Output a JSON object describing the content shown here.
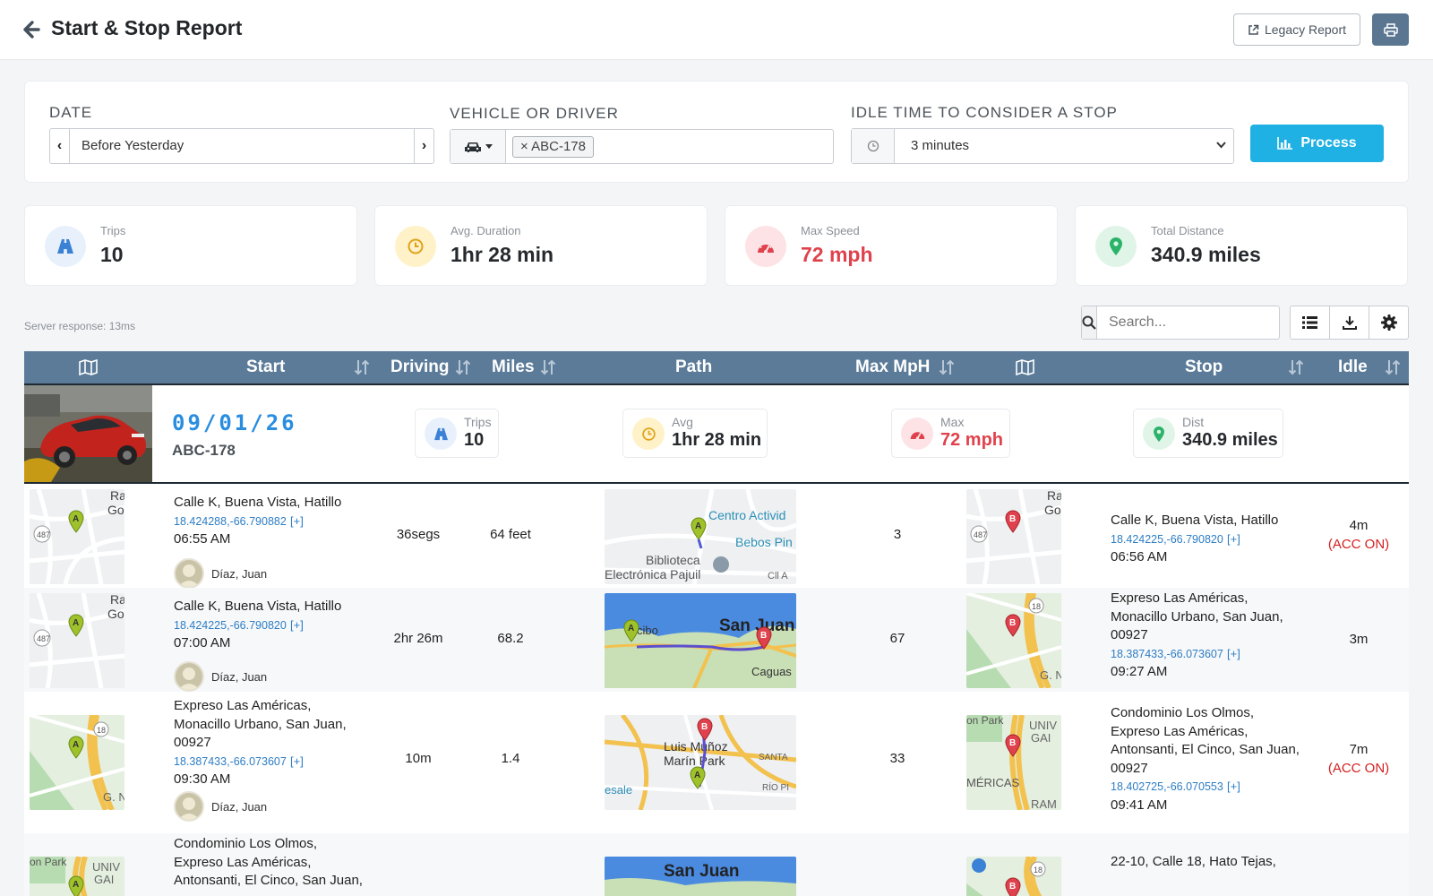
{
  "header": {
    "title": "Start & Stop Report",
    "legacy_label": "Legacy Report"
  },
  "filters": {
    "date_label": "DATE",
    "date_value": "Before Yesterday",
    "vehicle_label": "VEHICLE OR DRIVER",
    "vehicle_chip": "ABC-178",
    "idle_label": "IDLE TIME TO CONSIDER A STOP",
    "idle_value": "3 minutes",
    "process_label": "Process"
  },
  "stats": [
    {
      "label": "Trips",
      "value": "10",
      "icon": "road-icon"
    },
    {
      "label": "Avg. Duration",
      "value": "1hr 28 min",
      "icon": "clock-icon"
    },
    {
      "label": "Max Speed",
      "value": "72 mph",
      "icon": "speedometer-icon"
    },
    {
      "label": "Total Distance",
      "value": "340.9 miles",
      "icon": "map-marker-icon"
    }
  ],
  "server_response": "Server response: 13ms",
  "search": {
    "placeholder": "Search..."
  },
  "table": {
    "headers": [
      "Start",
      "Driving",
      "Miles",
      "Path",
      "Max MpH",
      "Stop",
      "Idle"
    ],
    "day": {
      "date": "09/01/26",
      "vehicle": "ABC-178",
      "trips_label": "Trips",
      "trips_value": "10",
      "avg_label": "Avg",
      "avg_value": "1hr 28 min",
      "max_label": "Max",
      "max_value": "72 mph",
      "dist_label": "Dist",
      "dist_value": "340.9 miles"
    },
    "rows": [
      {
        "start_lines": [
          "Calle K, Buena Vista, Hatillo"
        ],
        "start_coord": "18.424288,-66.790882",
        "plus": "[+]",
        "start_time": "06:55 AM",
        "driver": "Díaz, Juan",
        "driving": "36segs",
        "miles": "64 feet",
        "max_mph": "3",
        "stop_lines": [
          "Calle K, Buena Vista, Hatillo"
        ],
        "stop_coord": "18.424225,-66.790820",
        "stop_time": "06:56 AM",
        "idle": "4m",
        "acc": "(ACC ON)"
      },
      {
        "start_lines": [
          "Calle K, Buena Vista, Hatillo"
        ],
        "start_coord": "18.424225,-66.790820",
        "plus": "[+]",
        "start_time": "07:00 AM",
        "driver": "Díaz, Juan",
        "driving": "2hr 26m",
        "miles": "68.2",
        "max_mph": "67",
        "stop_lines": [
          "Expreso Las Américas,",
          "Monacillo Urbano, San Juan,",
          "00927"
        ],
        "stop_coord": "18.387433,-66.073607",
        "stop_time": "09:27 AM",
        "idle": "3m",
        "acc": ""
      },
      {
        "start_lines": [
          "Expreso Las Américas,",
          "Monacillo Urbano, San Juan,",
          "00927"
        ],
        "start_coord": "18.387433,-66.073607",
        "plus": "[+]",
        "start_time": "09:30 AM",
        "driver": "Díaz, Juan",
        "driving": "10m",
        "miles": "1.4",
        "max_mph": "33",
        "stop_lines": [
          "Condominio Los Olmos,",
          "Expreso Las Américas,",
          "Antonsanti, El Cinco, San Juan,",
          "00927"
        ],
        "stop_coord": "18.402725,-66.070553",
        "stop_time": "09:41 AM",
        "idle": "7m",
        "acc": "(ACC ON)"
      },
      {
        "start_lines": [
          "Condominio Los Olmos,",
          "Expreso Las Américas,",
          "Antonsanti, El Cinco, San Juan,"
        ],
        "stop_lines": [
          "22-10, Calle 18, Hato Tejas,"
        ]
      }
    ]
  },
  "map_labels": {
    "m1": [
      "Centro Activid",
      "Bebos Pin",
      "Biblioteca",
      "Electrónica Pajuil"
    ],
    "m2": [
      "San Juan",
      "Caguas"
    ],
    "m3": [
      "Luis Muñoz",
      "Marín Park"
    ],
    "m4": [
      "San Juan"
    ]
  },
  "colors": {
    "accent": "#1fb1e3",
    "header": "#5b7b99",
    "danger": "#d42020",
    "link": "#2d7dc4"
  }
}
